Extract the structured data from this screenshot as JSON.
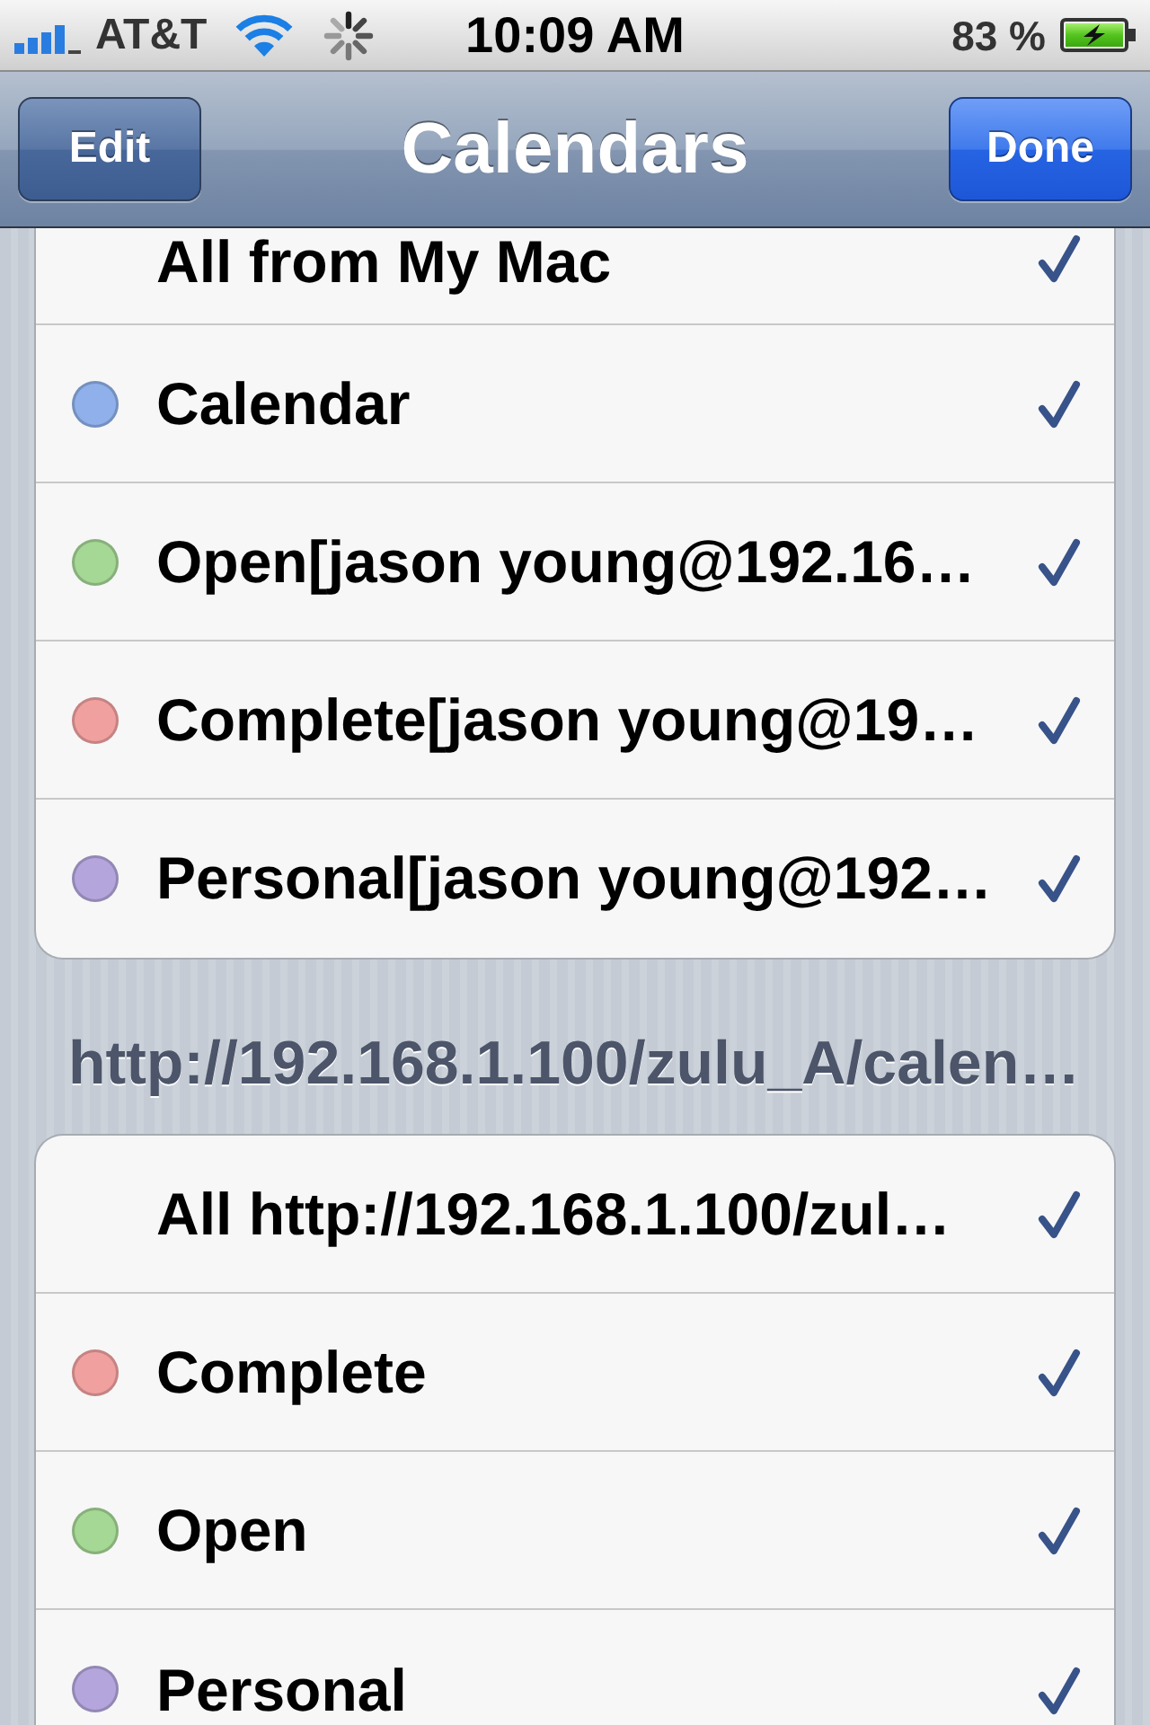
{
  "status_bar": {
    "carrier": "AT&T",
    "time": "10:09 AM",
    "battery_percent": "83 %"
  },
  "nav_bar": {
    "left_button": "Edit",
    "title": "Calendars",
    "right_button": "Done"
  },
  "groups": [
    {
      "rows": [
        {
          "kind": "all",
          "label": "All from My Mac",
          "checked": true
        },
        {
          "kind": "calendar",
          "label": "Calendar",
          "color": "#8fb0ea",
          "checked": true
        },
        {
          "kind": "calendar",
          "label": "Open[jason young@192.16…",
          "color": "#a5d795",
          "checked": true
        },
        {
          "kind": "calendar",
          "label": "Complete[jason young@19…",
          "color": "#f1a0a0",
          "checked": true
        },
        {
          "kind": "calendar",
          "label": "Personal[jason young@192…",
          "color": "#b4a6dc",
          "checked": true
        }
      ]
    },
    {
      "header": "http://192.168.1.100/zulu_A/calen…",
      "rows": [
        {
          "kind": "all",
          "label": "All http://192.168.1.100/zul…",
          "checked": true
        },
        {
          "kind": "calendar",
          "label": "Complete",
          "color": "#f1a0a0",
          "checked": true
        },
        {
          "kind": "calendar",
          "label": "Open",
          "color": "#a5d795",
          "checked": true
        },
        {
          "kind": "calendar",
          "label": "Personal",
          "color": "#b4a6dc",
          "checked": true
        }
      ]
    }
  ]
}
